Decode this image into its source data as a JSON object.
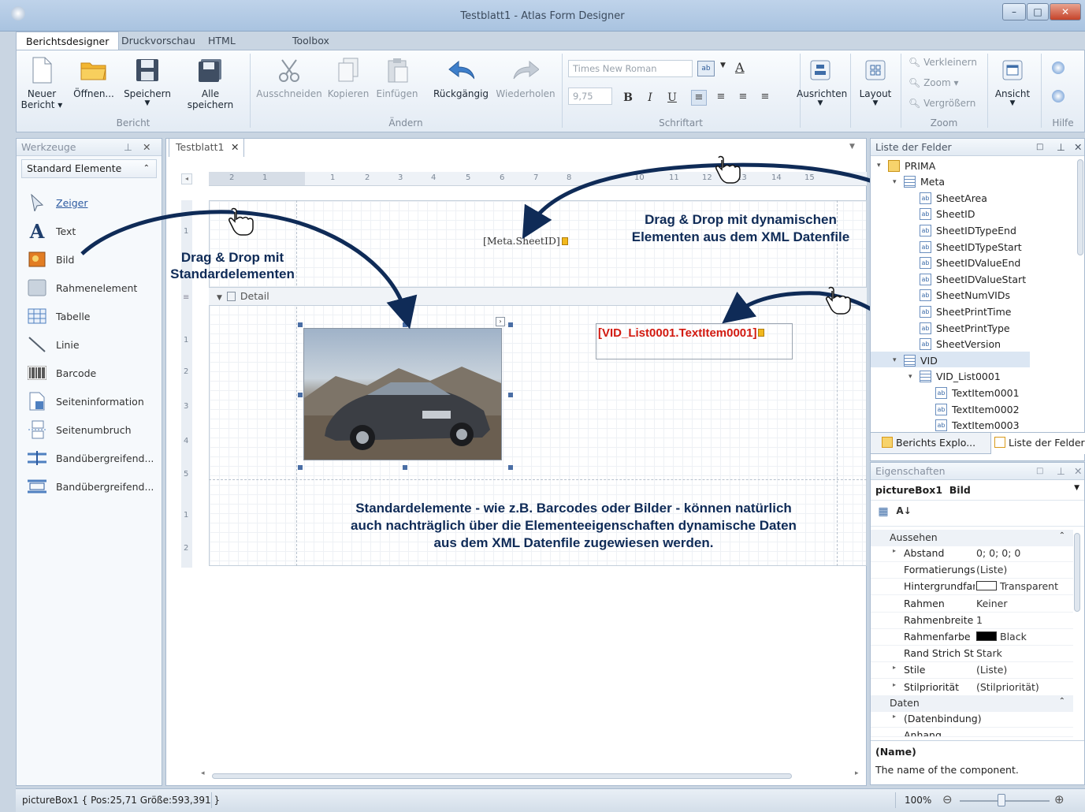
{
  "window": {
    "title": "Testblatt1 - Atlas Form Designer",
    "min": "–",
    "max": "□",
    "close": "✕"
  },
  "menu_tabs": [
    "Berichtsdesigner",
    "Druckvorschau",
    "HTML Ansicht",
    "Toolbox"
  ],
  "ribbon": {
    "groups": {
      "bericht": "Bericht",
      "aendern": "Ändern",
      "schriftart": "Schriftart",
      "zoom": "Zoom",
      "hilfe": "Hilfe"
    },
    "neuer_bericht_1": "Neuer",
    "neuer_bericht_2": "Bericht ▾",
    "oeffnen": "Öffnen...",
    "speichern": "Speichern",
    "alle_speichern": "Alle speichern",
    "ausschneiden": "Ausschneiden",
    "kopieren": "Kopieren",
    "einfuegen": "Einfügen",
    "rueckgaengig": "Rückgängig",
    "wiederholen": "Wiederholen",
    "font_name": "Times New Roman",
    "font_size": "9,75",
    "bold": "B",
    "italic": "I",
    "underline": "U",
    "ausrichten": "Ausrichten",
    "layout": "Layout",
    "verkleinern": "Verkleinern",
    "zoom": "Zoom",
    "vergroessern": "Vergrößern",
    "ansicht": "Ansicht"
  },
  "toolbox": {
    "title": "Werkzeuge",
    "pin": "⊥",
    "close": "✕",
    "section": "Standard Elemente",
    "tools": [
      "Zeiger",
      "Text",
      "Bild",
      "Rahmenelement",
      "Tabelle",
      "Linie",
      "Barcode",
      "Seiteninformation",
      "Seitenumbruch",
      "Bandübergreifend...",
      "Bandübergreifend..."
    ]
  },
  "document": {
    "tab": "Testblatt1",
    "detail_band": "Detail",
    "meta_field": "[Meta.SheetID]",
    "vid_field": "[VID_List0001.TextItem0001]",
    "ruler_top": [
      "2",
      "1",
      "1",
      "2",
      "3",
      "4",
      "5",
      "6",
      "7",
      "8",
      "10",
      "11",
      "12",
      "13",
      "14",
      "15"
    ],
    "ruler_left": [
      "1",
      "1",
      "2",
      "3",
      "4",
      "5",
      "1",
      "2"
    ]
  },
  "annotations": {
    "left_1": "Drag & Drop mit",
    "left_2": "Standardelementen",
    "right_1": "Drag & Drop mit dynamischen",
    "right_2": "Elementen aus dem XML Datenfile",
    "bottom_1": "Standardelemente - wie z.B. Barcodes oder Bilder - können natürlich",
    "bottom_2": "auch nachträglich über die Elementeeigenschaften dynamische Daten",
    "bottom_3": "aus dem XML Datenfile zugewiesen werden."
  },
  "fields_panel": {
    "title": "Liste der Felder",
    "tree": [
      "PRIMA",
      "Meta",
      "SheetArea",
      "SheetID",
      "SheetIDTypeEnd",
      "SheetIDTypeStart",
      "SheetIDValueEnd",
      "SheetIDValueStart",
      "SheetNumVIDs",
      "SheetPrintTime",
      "SheetPrintType",
      "SheetVersion",
      "VID",
      "VID_List0001",
      "TextItem0001",
      "TextItem0002",
      "TextItem0003"
    ],
    "tab_explorer": "Berichts Explo...",
    "tab_fields": "Liste der Felder"
  },
  "properties": {
    "title": "Eigenschaften",
    "selected_name": "pictureBox1",
    "selected_type": "Bild",
    "cat_aussehen": "Aussehen",
    "cat_daten": "Daten",
    "rows": [
      {
        "name": "Abstand",
        "value": "0; 0; 0; 0"
      },
      {
        "name": "Formatierungsre",
        "value": "(Liste)"
      },
      {
        "name": "Hintergrundfarb",
        "value": "Transparent"
      },
      {
        "name": "Rahmen",
        "value": "Keiner"
      },
      {
        "name": "Rahmenbreite",
        "value": "1"
      },
      {
        "name": "Rahmenfarbe",
        "value": "Black"
      },
      {
        "name": "Rand Strich Stil",
        "value": "Stark"
      },
      {
        "name": "Stile",
        "value": "(Liste)"
      },
      {
        "name": "Stilpriorität",
        "value": "(Stilpriorität)"
      }
    ],
    "daten_rows": [
      {
        "name": "(Datenbindung)",
        "value": ""
      },
      {
        "name": "Anhang",
        "value": ""
      }
    ],
    "desc_title": "(Name)",
    "desc_text": "The name of the component."
  },
  "status": {
    "text": "pictureBox1 { Pos:25,71 Größe:593,391 }",
    "zoom": "100%",
    "minus": "⊖",
    "plus": "⊕"
  },
  "colors": {
    "accent_navy": "#0f2b57",
    "field_red": "#d21a10"
  }
}
